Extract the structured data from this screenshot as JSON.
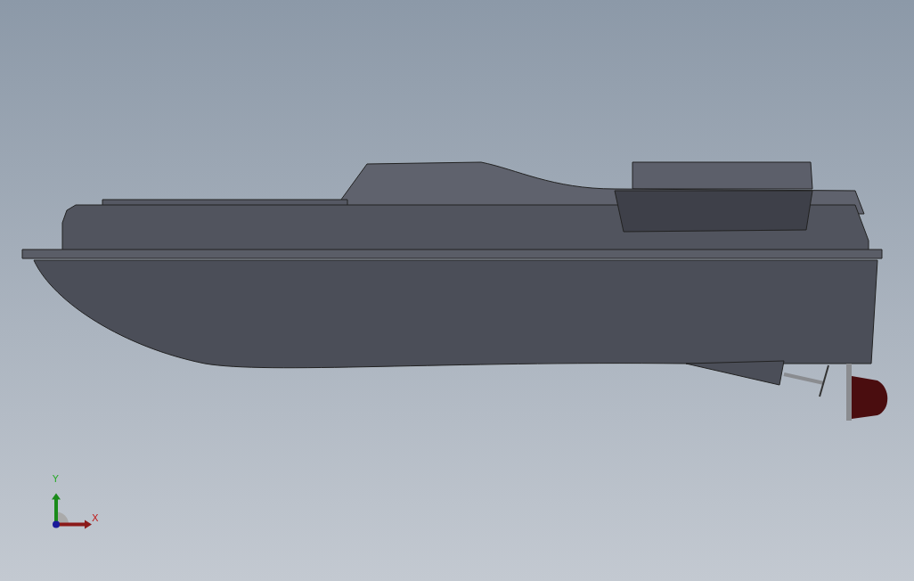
{
  "viewport": {
    "triad": {
      "y_label": "Y",
      "x_label": "X"
    }
  }
}
